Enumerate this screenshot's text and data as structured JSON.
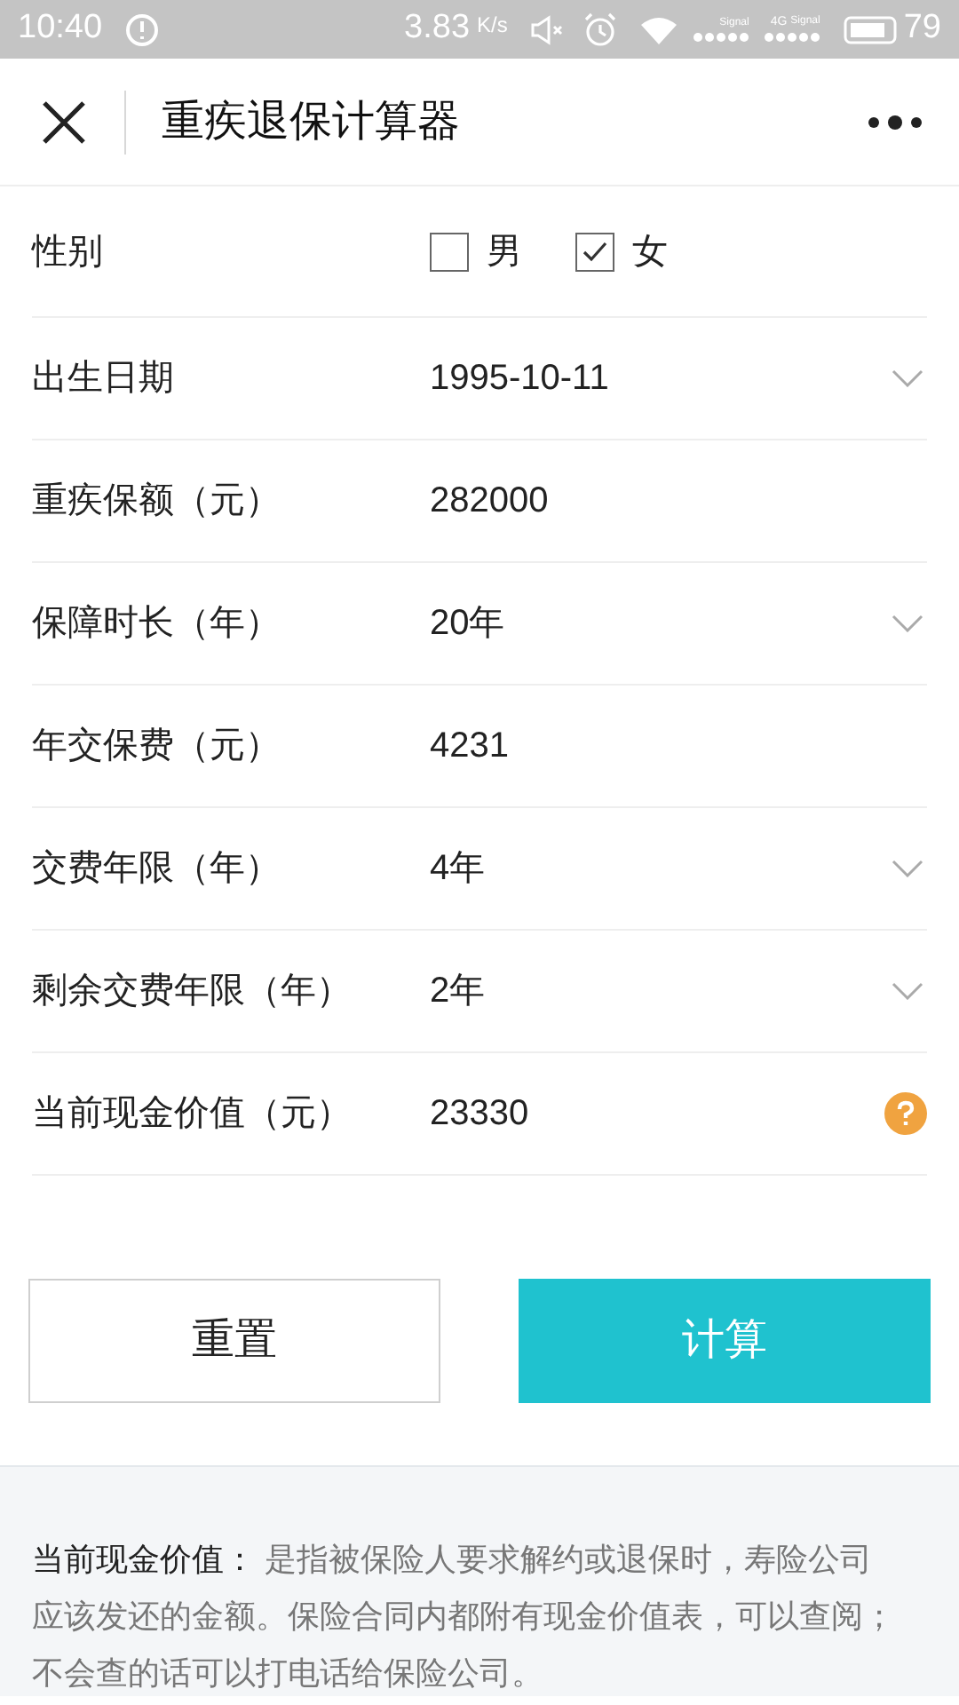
{
  "status_bar": {
    "time": "10:40",
    "speed": "3.83",
    "speed_unit": "K/s",
    "signal_labels": [
      "Signal",
      "Signal"
    ],
    "network": "4G",
    "battery": "79"
  },
  "header": {
    "title": "重疾退保计算器"
  },
  "form": [
    {
      "kind": "checkbox",
      "label": "性别",
      "options": [
        {
          "label": "男",
          "checked": false
        },
        {
          "label": "女",
          "checked": true
        }
      ]
    },
    {
      "kind": "dropdown",
      "label": "出生日期",
      "value": "1995-10-11"
    },
    {
      "kind": "input",
      "label": "重疾保额（元）",
      "value": "282000"
    },
    {
      "kind": "dropdown",
      "label": "保障时长（年）",
      "value": "20年"
    },
    {
      "kind": "input",
      "label": "年交保费（元）",
      "value": "4231"
    },
    {
      "kind": "dropdown",
      "label": "交费年限（年）",
      "value": "4年"
    },
    {
      "kind": "dropdown",
      "label": "剩余交费年限（年）",
      "value": "2年"
    },
    {
      "kind": "help",
      "label": "当前现金价值（元）",
      "value": "23330"
    }
  ],
  "buttons": [
    {
      "kind": "secondary",
      "label": "重置"
    },
    {
      "kind": "primary",
      "label": "计算"
    }
  ],
  "note": "**当前现金价值：** 是指被保险人要求解约或退保时，寿险公司应该发还的金额。保险合同内都附有现金价值表，可以查阅；不会查的话可以打电话给保险公司。"
}
